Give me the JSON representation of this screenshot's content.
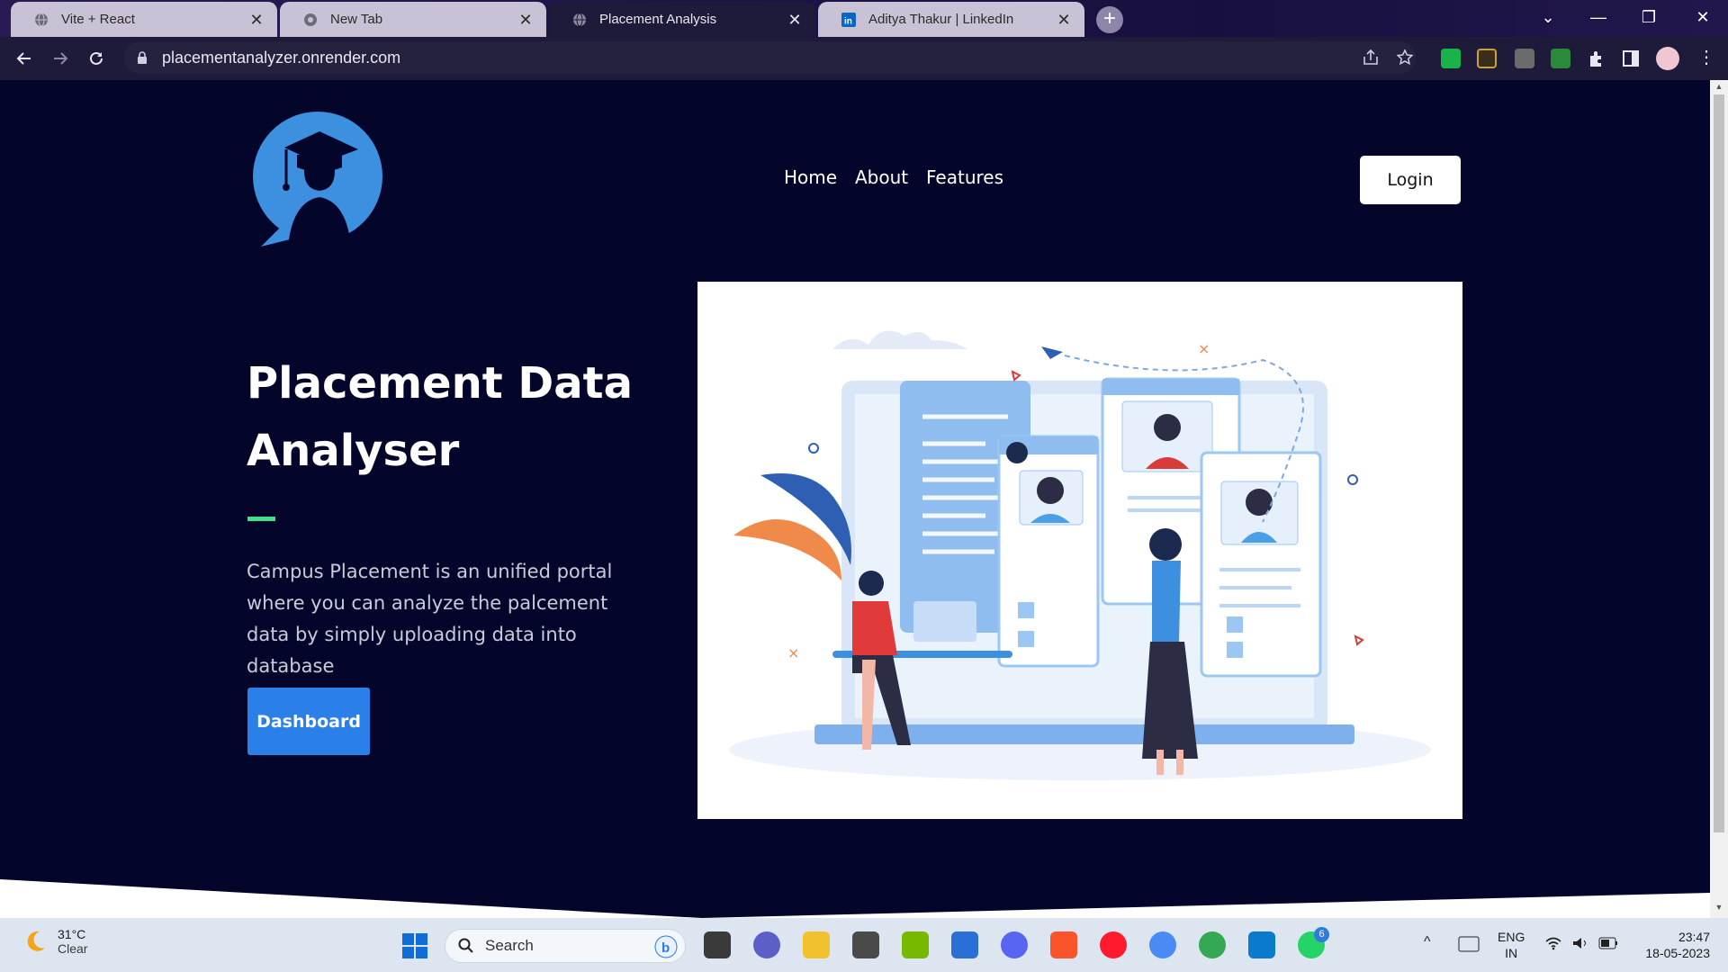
{
  "browser": {
    "tabs": [
      {
        "title": "Vite + React",
        "active": false
      },
      {
        "title": "New Tab",
        "active": false
      },
      {
        "title": "Placement Analysis",
        "active": true
      },
      {
        "title": "Aditya Thakur | LinkedIn",
        "active": false
      }
    ],
    "new_tab_symbol": "+",
    "url": "placementanalyzer.onrender.com",
    "window_controls": {
      "minimize": "—",
      "maximize": "❐",
      "close": "✕",
      "tab_search": "⌄"
    }
  },
  "site": {
    "nav": {
      "home": "Home",
      "about": "About",
      "features": "Features"
    },
    "login_label": "Login",
    "hero": {
      "title": "Placement Data Analyser",
      "description": "Campus Placement is an unified portal where you can analyze the palcement data by simply uploading data into database",
      "cta_label": "Dashboard"
    },
    "colors": {
      "background": "#03062a",
      "accent": "#3ee08a",
      "button": "#2b7fe8",
      "logo": "#3d8fe0"
    }
  },
  "taskbar": {
    "weather": {
      "temp": "31°C",
      "condition": "Clear"
    },
    "search_placeholder": "Search",
    "whatsapp_badge": "6",
    "language": {
      "lang": "ENG",
      "region": "IN"
    },
    "time": "23:47",
    "date": "18-05-2023"
  },
  "icons": [
    "back-icon",
    "forward-icon",
    "reload-icon",
    "lock-icon",
    "share-icon",
    "star-icon",
    "extensions-icon",
    "sidepanel-icon",
    "profile-icon",
    "menu-icon",
    "windows-start-icon",
    "search-icon",
    "bing-icon",
    "task-view-icon",
    "teams-icon",
    "file-explorer-icon",
    "sublime-icon",
    "nvidia-icon",
    "store-icon",
    "discord-icon",
    "brave-icon",
    "opera-icon",
    "chrome-icon",
    "vscode-icon",
    "whatsapp-icon",
    "wifi-icon",
    "volume-icon",
    "battery-icon"
  ]
}
